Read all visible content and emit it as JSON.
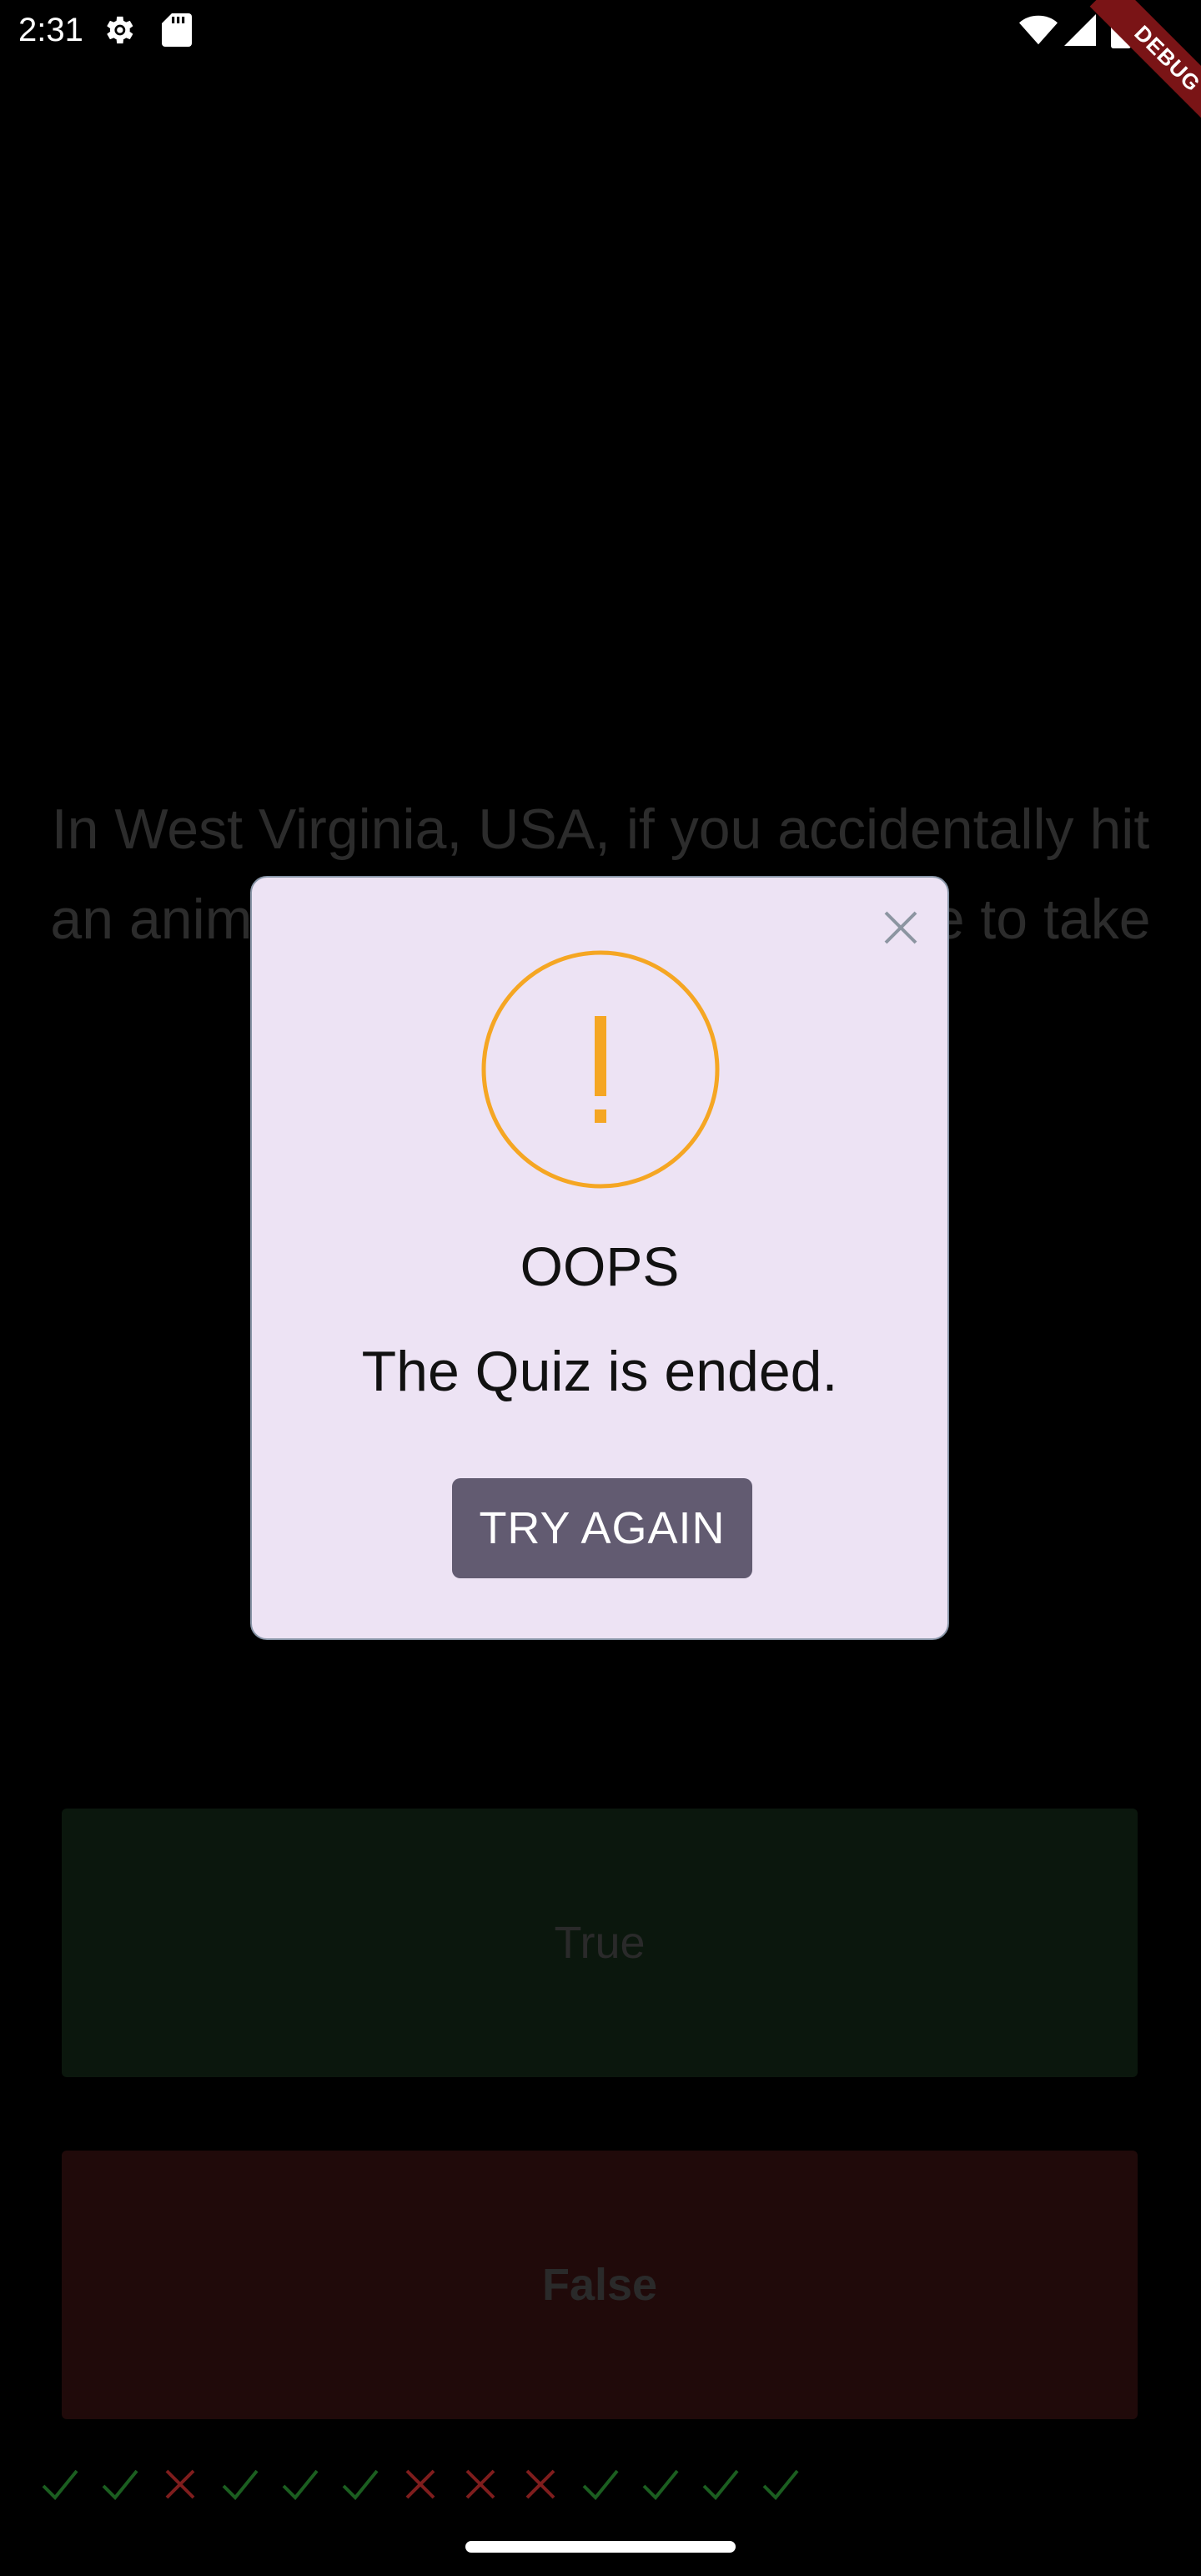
{
  "status_bar": {
    "time": "2:31",
    "icons": [
      "gear-icon",
      "sd-card-icon",
      "wifi-icon",
      "cell-signal-icon",
      "battery-icon"
    ]
  },
  "debug_banner": {
    "label": "DEBUG",
    "color": "#7a1416"
  },
  "quiz": {
    "question": "In West Virginia, USA, if you accidentally hit an animal with your car, you are free to take it home to eat.",
    "true_label": "True",
    "false_label": "False",
    "score_marks": [
      "check",
      "check",
      "cross",
      "check",
      "check",
      "check",
      "cross",
      "cross",
      "cross",
      "check",
      "check",
      "check",
      "check"
    ],
    "colors": {
      "check": "#1b5e20",
      "cross": "#7f1d1d",
      "true_button": "#0b170d",
      "false_button": "#200a0a"
    }
  },
  "dialog": {
    "icon": "warning-icon",
    "icon_color": "#f5a623",
    "title": "OOPS",
    "message": "The Quiz is ended.",
    "button_label": "TRY AGAIN",
    "background": "#ede3f4",
    "button_color": "#625b71"
  }
}
